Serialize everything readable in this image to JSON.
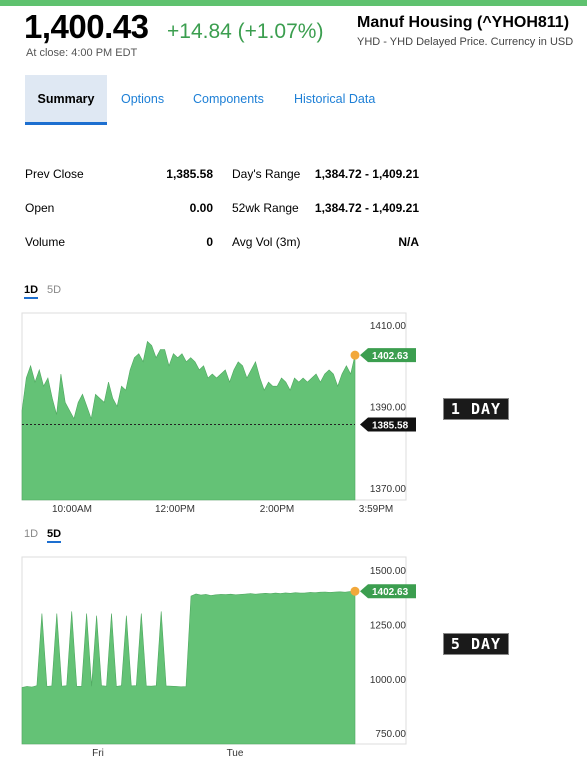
{
  "quote": {
    "price": "1,400.43",
    "change": "+14.84 (+1.07%)",
    "at_close": "At close: 4:00 PM EDT",
    "name": "Manuf Housing (^YHOH811)",
    "source": "YHD - YHD Delayed Price. Currency in USD"
  },
  "tabs": [
    {
      "label": "Summary",
      "active": true
    },
    {
      "label": "Options",
      "active": false
    },
    {
      "label": "Components",
      "active": false
    },
    {
      "label": "Historical Data",
      "active": false
    }
  ],
  "stats": {
    "prev_close_label": "Prev Close",
    "prev_close": "1,385.58",
    "open_label": "Open",
    "open": "0.00",
    "volume_label": "Volume",
    "volume": "0",
    "days_range_label": "Day's Range",
    "days_range": "1,384.72 - 1,409.21",
    "wk52_label": "52wk Range",
    "wk52": "1,384.72 - 1,409.21",
    "avg_vol_label": "Avg Vol (3m)",
    "avg_vol": "N/A"
  },
  "range_tabs_1": [
    {
      "label": "1D",
      "selected": true
    },
    {
      "label": "5D",
      "selected": false
    }
  ],
  "range_tabs_2": [
    {
      "label": "1D",
      "selected": false
    },
    {
      "label": "5D",
      "selected": true
    }
  ],
  "colors": {
    "up": "#3b9e4f",
    "fill": "#64c276",
    "accent": "#1d6fd0",
    "dot": "#f2a83b"
  },
  "chart_data": [
    {
      "type": "area",
      "ylim": [
        1367,
        1413
      ],
      "yticks": [
        "1410.00",
        "1390.00",
        "1370.00"
      ],
      "ytick_values": [
        1410,
        1390,
        1370
      ],
      "xticks": [
        "10:00AM",
        "12:00PM",
        "2:00PM",
        "3:59PM"
      ],
      "current_label": "1402.63",
      "current_value": 1402.63,
      "prev_close_label": "1385.58",
      "prev_close_value": 1385.58,
      "values": [
        1389,
        1397,
        1400,
        1396,
        1399,
        1395,
        1397,
        1392,
        1388,
        1398,
        1391,
        1389,
        1387,
        1391,
        1393,
        1390,
        1387,
        1393,
        1392,
        1391,
        1396,
        1392,
        1390,
        1395,
        1394,
        1399,
        1402,
        1403,
        1401,
        1406,
        1405,
        1402,
        1404,
        1404,
        1400,
        1403,
        1402,
        1403,
        1401,
        1402,
        1401,
        1399,
        1400,
        1397,
        1398,
        1397,
        1398,
        1399,
        1396,
        1399,
        1401,
        1400,
        1397,
        1399,
        1401,
        1397,
        1394,
        1396,
        1395,
        1395,
        1397,
        1396,
        1394,
        1397,
        1396,
        1397,
        1396,
        1397,
        1398,
        1396,
        1398,
        1399,
        1398,
        1395,
        1398,
        1400,
        1398,
        1402.63
      ],
      "tag": "1 DAY"
    },
    {
      "type": "area",
      "ylim": [
        700,
        1560
      ],
      "yticks": [
        "1500.00",
        "1250.00",
        "1000.00",
        "750.00"
      ],
      "ytick_values": [
        1500,
        1250,
        1000,
        750
      ],
      "xticks": [
        "Fri",
        "Tue"
      ],
      "current_label": "1402.63",
      "current_value": 1402.63,
      "values": [
        960,
        965,
        962,
        968,
        1300,
        965,
        967,
        1300,
        966,
        968,
        1310,
        966,
        965,
        1300,
        966,
        1290,
        968,
        966,
        1300,
        965,
        968,
        1290,
        967,
        969,
        1300,
        967,
        966,
        968,
        1310,
        967,
        966,
        965,
        963,
        964,
        1380,
        1390,
        1385,
        1388,
        1383,
        1386,
        1388,
        1387,
        1389,
        1386,
        1388,
        1390,
        1392,
        1389,
        1391,
        1393,
        1391,
        1394,
        1392,
        1395,
        1393,
        1396,
        1394,
        1395,
        1397,
        1396,
        1398,
        1399,
        1397,
        1399,
        1400,
        1398,
        1401,
        1402.63
      ],
      "tag": "5 DAY"
    }
  ]
}
